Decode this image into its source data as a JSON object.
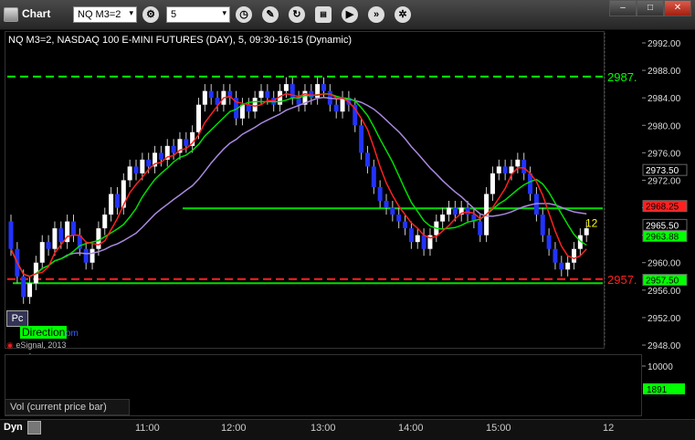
{
  "window": {
    "title": "Chart"
  },
  "toolbar": {
    "symbol": "NQ M3=2",
    "interval": "5",
    "icons": [
      "clock-icon",
      "pencil-icon",
      "refresh-icon",
      "studies-icon",
      "play-icon",
      "forward-icon",
      "settings-icon"
    ]
  },
  "chart": {
    "header": "NQ M3=2, NASDAQ 100 E-MINI FUTURES (DAY), 5, 09:30-16:15 (Dynamic)",
    "copyright": "eSignal, 2013",
    "pc_button": "Pc",
    "direction_label": "Direction",
    "direction_suffix": "om",
    "marker_label": "12",
    "level_high": "2987.",
    "level_low": "2957.",
    "y_ticks": [
      "2992.00",
      "2988.00",
      "2984.00",
      "2980.00",
      "2976.00",
      "2972.00",
      "2968.00",
      "2964.00",
      "2960.00",
      "2956.00",
      "2952.00",
      "2948.00"
    ],
    "price_labels": [
      {
        "text": "2973.50",
        "bg": "#000000",
        "fg": "#ffffff",
        "value": 2973.5
      },
      {
        "text": "2968.25",
        "bg": "#ff2020",
        "fg": "#000000",
        "value": 2968.25
      },
      {
        "text": "2965.50",
        "bg": "#000000",
        "fg": "#ffffff",
        "value": 2965.5
      },
      {
        "text": "2963.88",
        "bg": "#00ff00",
        "fg": "#000000",
        "value": 2963.88
      },
      {
        "text": "2957.50",
        "bg": "#00ff00",
        "fg": "#000000",
        "value": 2957.5
      }
    ],
    "x_ticks": [
      "11:00",
      "12:00",
      "13:00",
      "14:00",
      "15:00",
      "12"
    ],
    "colors": {
      "up": "#ffffff",
      "down": "#2233ff",
      "ma_red": "#ff2020",
      "ma_green": "#00dd00",
      "ma_purple": "#aa88dd",
      "level_green": "#00ff00",
      "level_red": "#ff2020"
    }
  },
  "volume": {
    "label": "Vol (current price bar)",
    "y_tick": "10000",
    "current": "1891"
  },
  "bottom": {
    "mode": "Dyn"
  }
}
